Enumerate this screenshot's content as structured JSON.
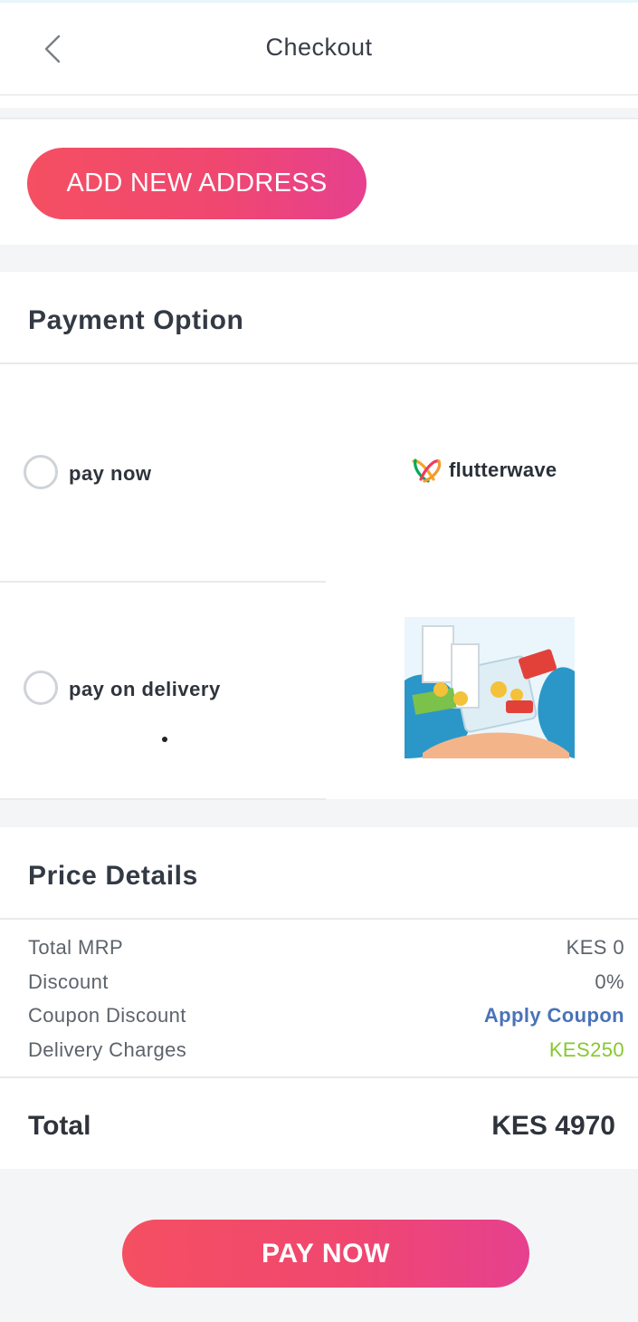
{
  "header": {
    "title": "Checkout",
    "back_icon": "chevron-left-icon"
  },
  "address": {
    "add_button_label": "ADD NEW ADDRESS"
  },
  "payment": {
    "title": "Payment Option",
    "options": [
      {
        "label": "pay now",
        "provider_logo_text": "flutterwave",
        "selected": false
      },
      {
        "label": "pay on delivery",
        "image": "mobile-payment-illustration",
        "selected": false
      }
    ]
  },
  "price_details": {
    "title": "Price Details",
    "rows": [
      {
        "label": "Total MRP",
        "value": "KES 0"
      },
      {
        "label": "Discount",
        "value": "0%"
      },
      {
        "label": "Coupon Discount",
        "value": "Apply Coupon"
      },
      {
        "label": "Delivery Charges",
        "value": "KES250"
      }
    ],
    "total_label": "Total",
    "total_value": "KES 4970"
  },
  "footer": {
    "pay_button_label": "PAY NOW"
  },
  "colors": {
    "accent_gradient_start": "#f54f62",
    "accent_gradient_end": "#e6408f",
    "coupon_link": "#4a73b8",
    "delivery_charge": "#86c82e"
  }
}
